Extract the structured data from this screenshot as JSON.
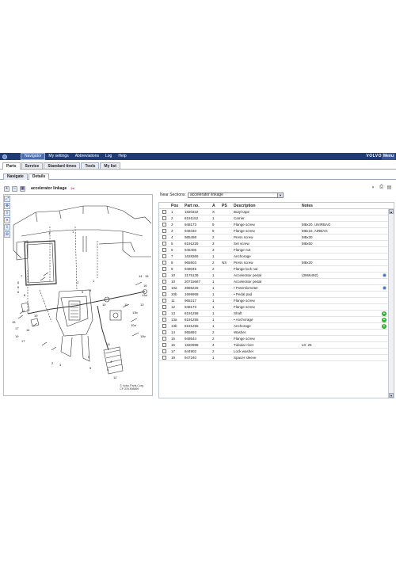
{
  "topbar": {
    "menu": [
      "Navigator",
      "My settings",
      "Abbreviations",
      "Log",
      "Help"
    ],
    "brand": "VOLVO",
    "menu_right": "Menu"
  },
  "tabs1": [
    "Parts",
    "Service",
    "Standard times",
    "Tools",
    "My list"
  ],
  "tabs2": [
    "Navigate",
    "Details"
  ],
  "left": {
    "title": "accelerator linkage",
    "copyright_line1": "© Volvo Parts Corp.",
    "copyright_line2": "CF 378 808869"
  },
  "near_sections": {
    "label": "Near Sections:",
    "value": "accelerator linkage"
  },
  "table": {
    "headers": {
      "pos": "Pos",
      "part": "Part no.",
      "a": "A",
      "ps": "PS",
      "desc": "Description",
      "notes": "Notes"
    },
    "rows": [
      {
        "pos": "1",
        "part": "1820332",
        "a": "X",
        "ps": "",
        "desc": "Butyl tape",
        "notes": "",
        "icon": ""
      },
      {
        "pos": "2",
        "part": "8191152",
        "a": "1",
        "ps": "",
        "desc": "Carrier",
        "notes": "",
        "icon": ""
      },
      {
        "pos": "3",
        "part": "948173",
        "a": "9",
        "ps": "",
        "desc": "Flange screw",
        "notes": "M8x20, UNIRBAG",
        "icon": ""
      },
      {
        "pos": "3",
        "part": "949440",
        "a": "9",
        "ps": "",
        "desc": "Flange screw",
        "notes": "M8x16, AIRBAG",
        "icon": ""
      },
      {
        "pos": "4",
        "part": "985498",
        "a": "2",
        "ps": "",
        "desc": "Press screw",
        "notes": "M8x30",
        "icon": ""
      },
      {
        "pos": "5",
        "part": "8191226",
        "a": "3",
        "ps": "",
        "desc": "Set screw",
        "notes": "M8x60",
        "icon": ""
      },
      {
        "pos": "6",
        "part": "945406",
        "a": "3",
        "ps": "",
        "desc": "Flange nut",
        "notes": "",
        "icon": ""
      },
      {
        "pos": "7",
        "part": "1628366",
        "a": "1",
        "ps": "",
        "desc": "Anchorage",
        "notes": "",
        "icon": ""
      },
      {
        "pos": "8",
        "part": "965503",
        "a": "2",
        "ps": "NS",
        "desc": "Press screw",
        "notes": "M8x20",
        "icon": ""
      },
      {
        "pos": "9",
        "part": "949045",
        "a": "2",
        "ps": "",
        "desc": "Flange lock nut",
        "notes": "",
        "icon": ""
      },
      {
        "pos": "10",
        "part": "3175139",
        "a": "1",
        "ps": "",
        "desc": "Accelerator pedal",
        "notes": "(3966492)",
        "icon": "info"
      },
      {
        "pos": "10",
        "part": "20715667",
        "a": "1",
        "ps": "",
        "desc": "Accelerator pedal",
        "notes": "",
        "icon": ""
      },
      {
        "pos": "10a",
        "part": "3985226",
        "a": "1",
        "ps": "",
        "desc": "• Potentiometer",
        "notes": "",
        "icon": "info"
      },
      {
        "pos": "10b",
        "part": "1699958",
        "a": "1",
        "ps": "",
        "desc": "• Pedal pad",
        "notes": "",
        "icon": ""
      },
      {
        "pos": "11",
        "part": "965217",
        "a": "1",
        "ps": "",
        "desc": "Flange screw",
        "notes": "",
        "icon": ""
      },
      {
        "pos": "12",
        "part": "948173",
        "a": "1",
        "ps": "",
        "desc": "Flange screw",
        "notes": "",
        "icon": ""
      },
      {
        "pos": "13",
        "part": "8191258",
        "a": "1",
        "ps": "",
        "desc": "Shaft",
        "notes": "",
        "icon": "add"
      },
      {
        "pos": "13a",
        "part": "8191255",
        "a": "1",
        "ps": "",
        "desc": "• Anchorage",
        "notes": "",
        "icon": "add"
      },
      {
        "pos": "13b",
        "part": "8191255",
        "a": "1",
        "ps": "",
        "desc": "Anchorage",
        "notes": "",
        "icon": "add"
      },
      {
        "pos": "14",
        "part": "955893",
        "a": "2",
        "ps": "",
        "desc": "Washer",
        "notes": "",
        "icon": ""
      },
      {
        "pos": "15",
        "part": "949544",
        "a": "2",
        "ps": "",
        "desc": "Flange screw",
        "notes": "",
        "icon": ""
      },
      {
        "pos": "16",
        "part": "1820988",
        "a": "4",
        "ps": "",
        "desc": "Tubular rivet",
        "notes": "L0: 25",
        "icon": ""
      },
      {
        "pos": "17",
        "part": "944902",
        "a": "2",
        "ps": "",
        "desc": "Lock washer",
        "notes": "",
        "icon": ""
      },
      {
        "pos": "19",
        "part": "947240",
        "a": "1",
        "ps": "",
        "desc": "Spacer sleeve",
        "notes": "",
        "icon": ""
      }
    ]
  }
}
